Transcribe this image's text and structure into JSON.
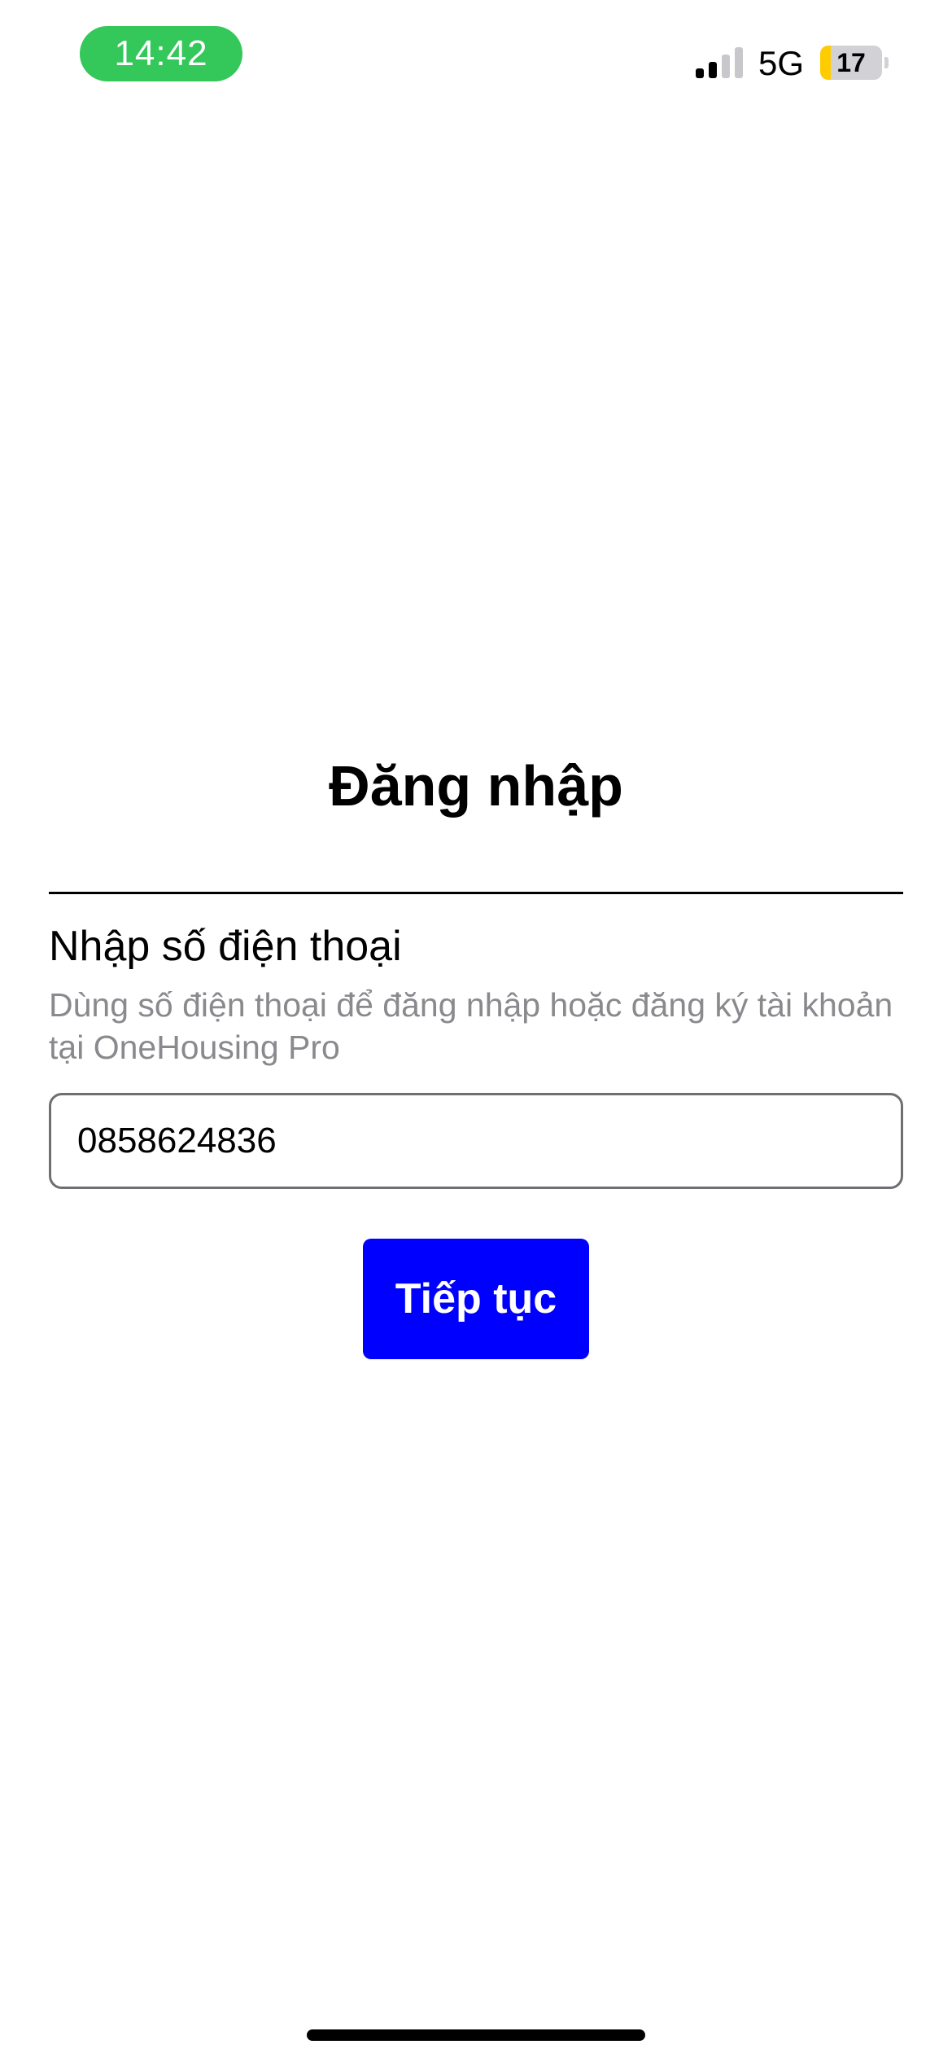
{
  "status_bar": {
    "time": "14:42",
    "network": "5G",
    "battery_level": "17",
    "battery_fraction": 0.17,
    "signal_bars_active": 2,
    "signal_bars_total": 4,
    "time_pill_color": "#34c759",
    "battery_fill_color": "#ffcc00"
  },
  "login": {
    "title": "Đăng nhập",
    "field_label": "Nhập số điện thoại",
    "field_hint": "Dùng số điện thoại để đăng nhập hoặc đăng ký tài khoản tại OneHousing Pro",
    "phone_value": "0858624836",
    "continue_label": "Tiếp tục",
    "accent_color": "#0000ff"
  }
}
